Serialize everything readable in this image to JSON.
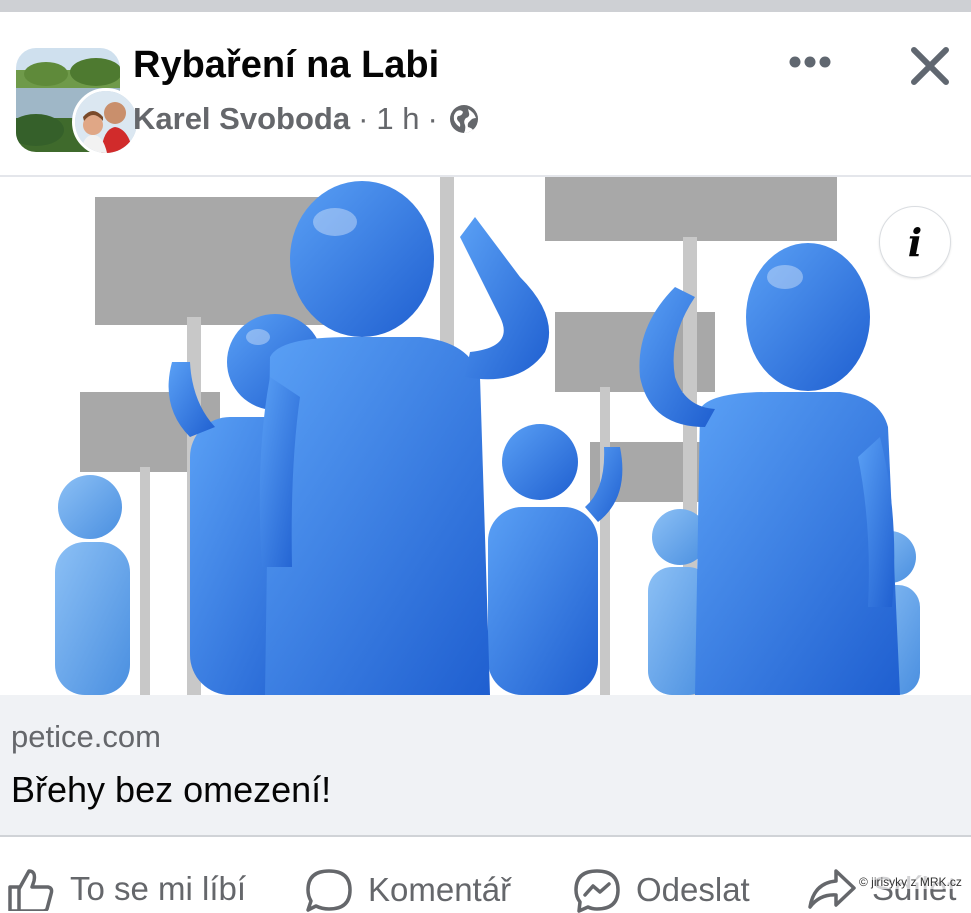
{
  "post": {
    "group_name": "Rybaření na Labi",
    "author": "Karel Svoboda",
    "separator": "·",
    "time": "1 h",
    "audience_icon": "globe-icon"
  },
  "header_actions": {
    "more_icon": "more-horizontal-icon",
    "close_icon": "close-icon"
  },
  "link_preview": {
    "image_description_icon": "info-icon",
    "domain": "petice.com",
    "title": "Břehy bez omezení!"
  },
  "actions": {
    "like_label": "To se mi líbí",
    "comment_label": "Komentář",
    "send_label": "Odeslat",
    "share_label": "Sdílet"
  },
  "watermark": "© jirisyky z MRK.cz",
  "colors": {
    "text_primary": "#050505",
    "text_secondary": "#65676b",
    "caption_bg": "#f0f2f5",
    "figure_blue": "#2f73e0"
  }
}
